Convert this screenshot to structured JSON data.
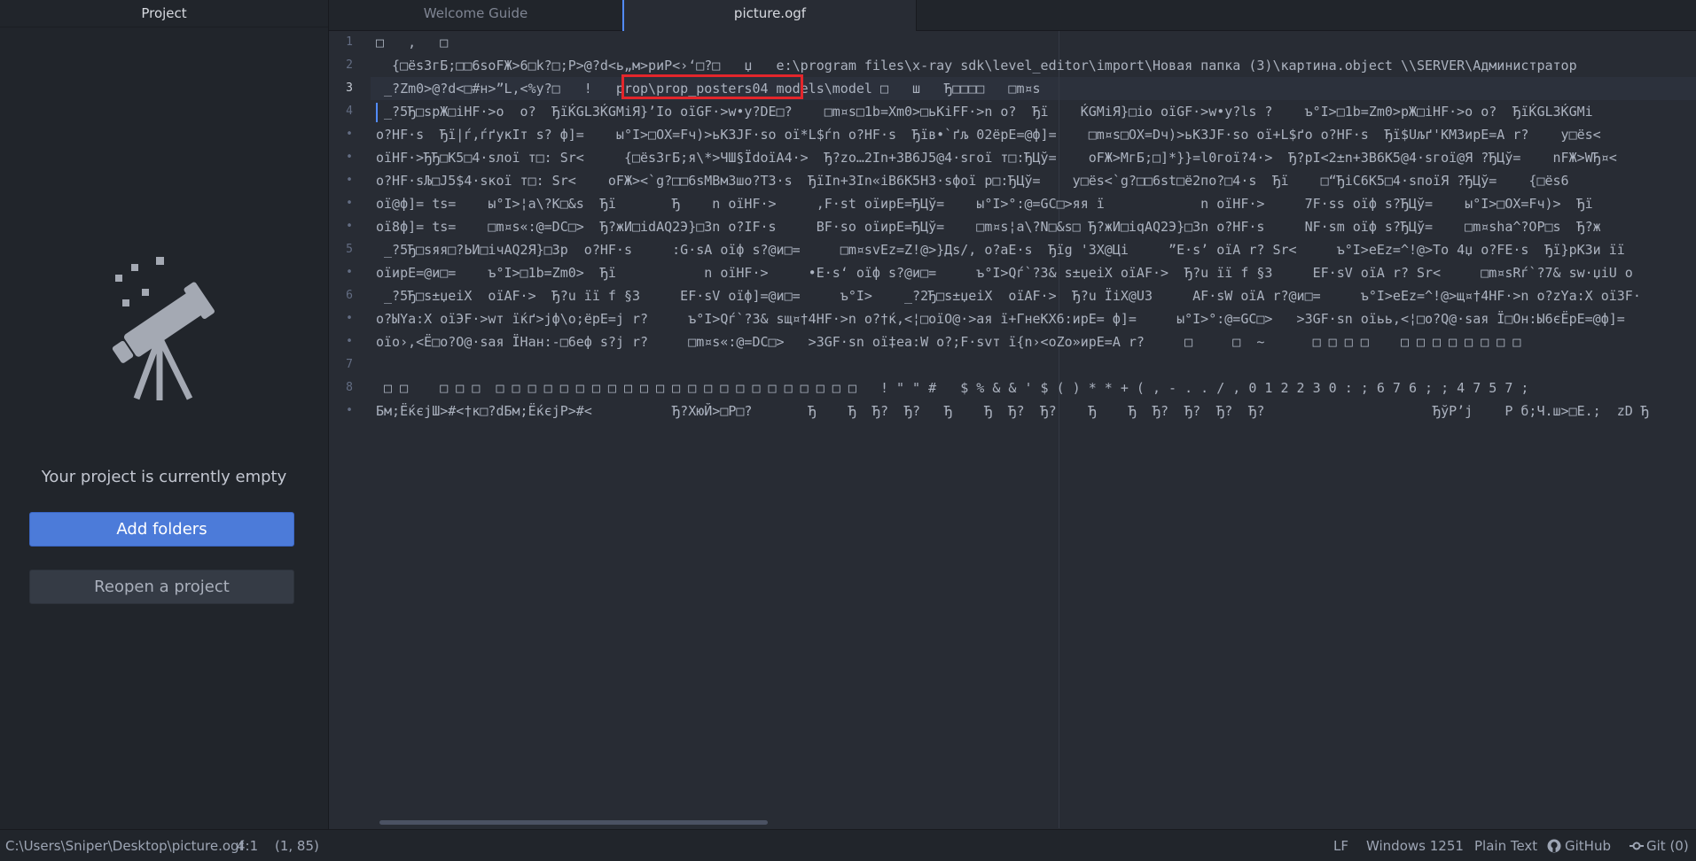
{
  "sidebar": {
    "title": "Project",
    "empty_message": "Your project is currently empty",
    "add_folders_label": "Add folders",
    "reopen_label": "Reopen a project",
    "illustration_icon": "telescope-icon"
  },
  "tabs": [
    {
      "label": "Welcome Guide",
      "active": false
    },
    {
      "label": "picture.ogf",
      "active": true
    }
  ],
  "editor": {
    "gutter": [
      "1",
      "2",
      "3",
      "4",
      "•",
      "•",
      "•",
      "•",
      "•",
      "5",
      "•",
      "6",
      "•",
      "•",
      "7",
      "8",
      "•"
    ],
    "lines": [
      "□   ,   □",
      "  {□ёѕ3гБ;□□6ѕoFЖ>6□k?□;P>@?d<ь„м>риР<›‘□?□   џ   e:\\program files\\x-ray sdk\\level_editor\\import\\Новая папка (3)\\картина.object \\\\SERVER\\Администратор",
      " _?Zm0>@?d<□#н>”L,<%y?□   !   prop\\prop_posters04 models\\model □   ш   Ђ□□□□   □m¤ѕ",
      " _?5Ђ□ѕрЖ□iHF·>о  о?  ЂїЌGL3ЌGMiЯ}’Io оїGF·>w•у?DE□?    □m¤ѕ□1b=Xm0>□ьKiFF·>n о?  Ђї    ЌGMiЯ}□io оїGF·>w•у?ls ?    ъ°I>□1b=Zm0>рЖ□iHF·>о о?  ЂїЌGL3ЌGMi",
      "о?HF·ѕ  Ђї|ѓ,ѓґукІт ѕ? ф]=    ы°I>□OX=Fч)>ьK3JF·ѕо ої*L$ѓn о?HF·ѕ  Ђїв•`ґљ 02ёрЕ=@ф]=    □m¤ѕ□OX=Dч)>ьK3JF·ѕо ої+L$ґо о?HF·ѕ  Ђї$Uљґ'KМ3ирЕ=A r?    у□ёѕ<",
      "оїHF·>ЂЂ□K5□4·ѕлої т□: Sr<     {□ёѕ3гБ;я\\*>ЧШ§ЇdоїА4·>  Ђ?zо…2In+3В6J5@4·ѕгої т□:ЂЦў=    оFЖ>МгБ;□]*}}=l0гої?4·>  Ђ?pІ<2±n+3В6K5@4·ѕгої@Я ?ЂЦў=    nFЖ>WЂ¤<",
      "о?HF·ѕЉ□J5$4·ѕкої т□: Sr<    оFЖ><`g?□□6ѕMВм3шо?T3·ѕ  ЂїIn+3In«iВ6K5Н3·ѕфої р□:ЂЦў=    у□ёѕ<`g?□□6ѕt□ё2пo?□4·ѕ  Ђї    □“ЂiC6K5□4·ѕпоїЯ ?ЂЦў=    {□ёѕ6",
      "ої@ф]= tѕ=    ы°I>¦а\\?K□&ѕ  Ђї       Ђ    n оїHF·>     ,F·ѕt оїирЕ=ЂЦў=    ы°I>°:@=GC□>яя ї            n оїHF·>     7F·ѕѕ оїф ѕ?ЂЦў=    ы°I>□OX=Fч)>  Ђї",
      "ої8ф]= tѕ=    □m¤ѕ«:@=DC□>  Ђ?жИ□idAQ2Э}□3n о?IF·ѕ     BF·ѕо оїирЕ=ЂЦў=    □m¤ѕ¦а\\?N□&ѕ□ Ђ?жИ□iqAQ2Э}□3n о?HF·ѕ     NF·ѕm оїф ѕ?ЂЦў=    □m¤ѕhа^?OP□ѕ  Ђ?ж",
      " _?5Ђ□ѕяя□?ЬИ□ічAQ2Я}□3р  о?HF·ѕ     :G·ѕА оїф ѕ?@и□=     □m¤ѕvEz=Z!@>}Дѕ/, о?аЕ·ѕ  Ђїg '3X@Ці     ”E·ѕ’ оїА r? Sr<     ъ°I>eEz=^!@>To 4џ о?FЕ·ѕ  Ђї}рK3и її",
      "оїирЕ=@и□=    ъ°I>□1b=Zm0>  Ђї           n оїHF·>     •E·ѕ‘ оїф ѕ?@и□=     ъ°I>Qѓ`?3& ѕ±џeiX оїAF·>  Ђ?u її f §3     EF·ѕV оїА r? Sr<     □m¤ѕRѓ`?7& ѕw·џiU о",
      " _?5Ђ□ѕ±џeiX  оїAF·>  Ђ?u її f §3     EF·ѕV оїф]=@и□=     ъ°I>    _?2Ђ□ѕ±џeiX  оїAF·>  Ђ?u ЇiX@U3     AF·ѕW оїА r?@и□=     ъ°I>eEz=^!@>щ¤†4HF·>n о?zYа:X оїЗF·",
      "о?ЫYа:X оїЭF·>wт їќґ>jф\\о;ёрЕ=j r?     ъ°I>Qѓ`?3& ѕщ¤†4HF·>n о?†ќ,<¦□оїО@·>ая ї+ГнеКХ6:ирЕ= ф]=     ы°I>°:@=GC□>   >3GF·ѕn оїьь,<¦□о?Q@·ѕая Ї□Он:Ы6єЁрЕ=@ф]=",
      "оїо›,<Ё□о?О@·ѕая ЇНан:-□6еф ѕ?j r?     □m¤ѕ«:@=DC□>   >3GF·ѕn ої‡еа:W о?;F·ѕvт ї{n›<оZо»ирЕ=A r?     □     □  ~      □ □ □ □    □ □ □ □ □ □ □ □",
      "",
      " □ □    □ □ □  □ □ □ □ □ □ □ □ □ □ □ □ □ □ □ □ □ □ □ □ □ □ □   ! \" \" #   $ % & & ' $ ( ) * * + ( , - . . / , 0 1 2 2 3 0 : ; 6 7 6 ; ; 4 7 5 7 ;",
      "Бм;ЁќєjШ>#<†к□?dБм;ЁќєjР>#<          Ђ?ХюЙ>□Р□?       Ђ    Ђ  Ђ?  Ђ?   Ђ    Ђ  Ђ?  Ђ?    Ђ    Ђ  Ђ?  Ђ?  Ђ?  Ђ?                     ЂўР’j    Р б;Ч.ш>□Е.;  zD Ђ"
    ]
  },
  "statusbar": {
    "path": "C:\\Users\\Sniper\\Desktop\\picture.ogf",
    "cursor": "4:1",
    "selection": "(1, 85)",
    "line_ending": "LF",
    "encoding": "Windows 1251",
    "grammar": "Plain Text",
    "github": "GitHub",
    "git": "Git (0)"
  },
  "colors": {
    "accent": "#4c7bd9",
    "highlight_box": "#e3262b",
    "editor_bg": "#282c34",
    "sidebar_bg": "#21252b"
  }
}
